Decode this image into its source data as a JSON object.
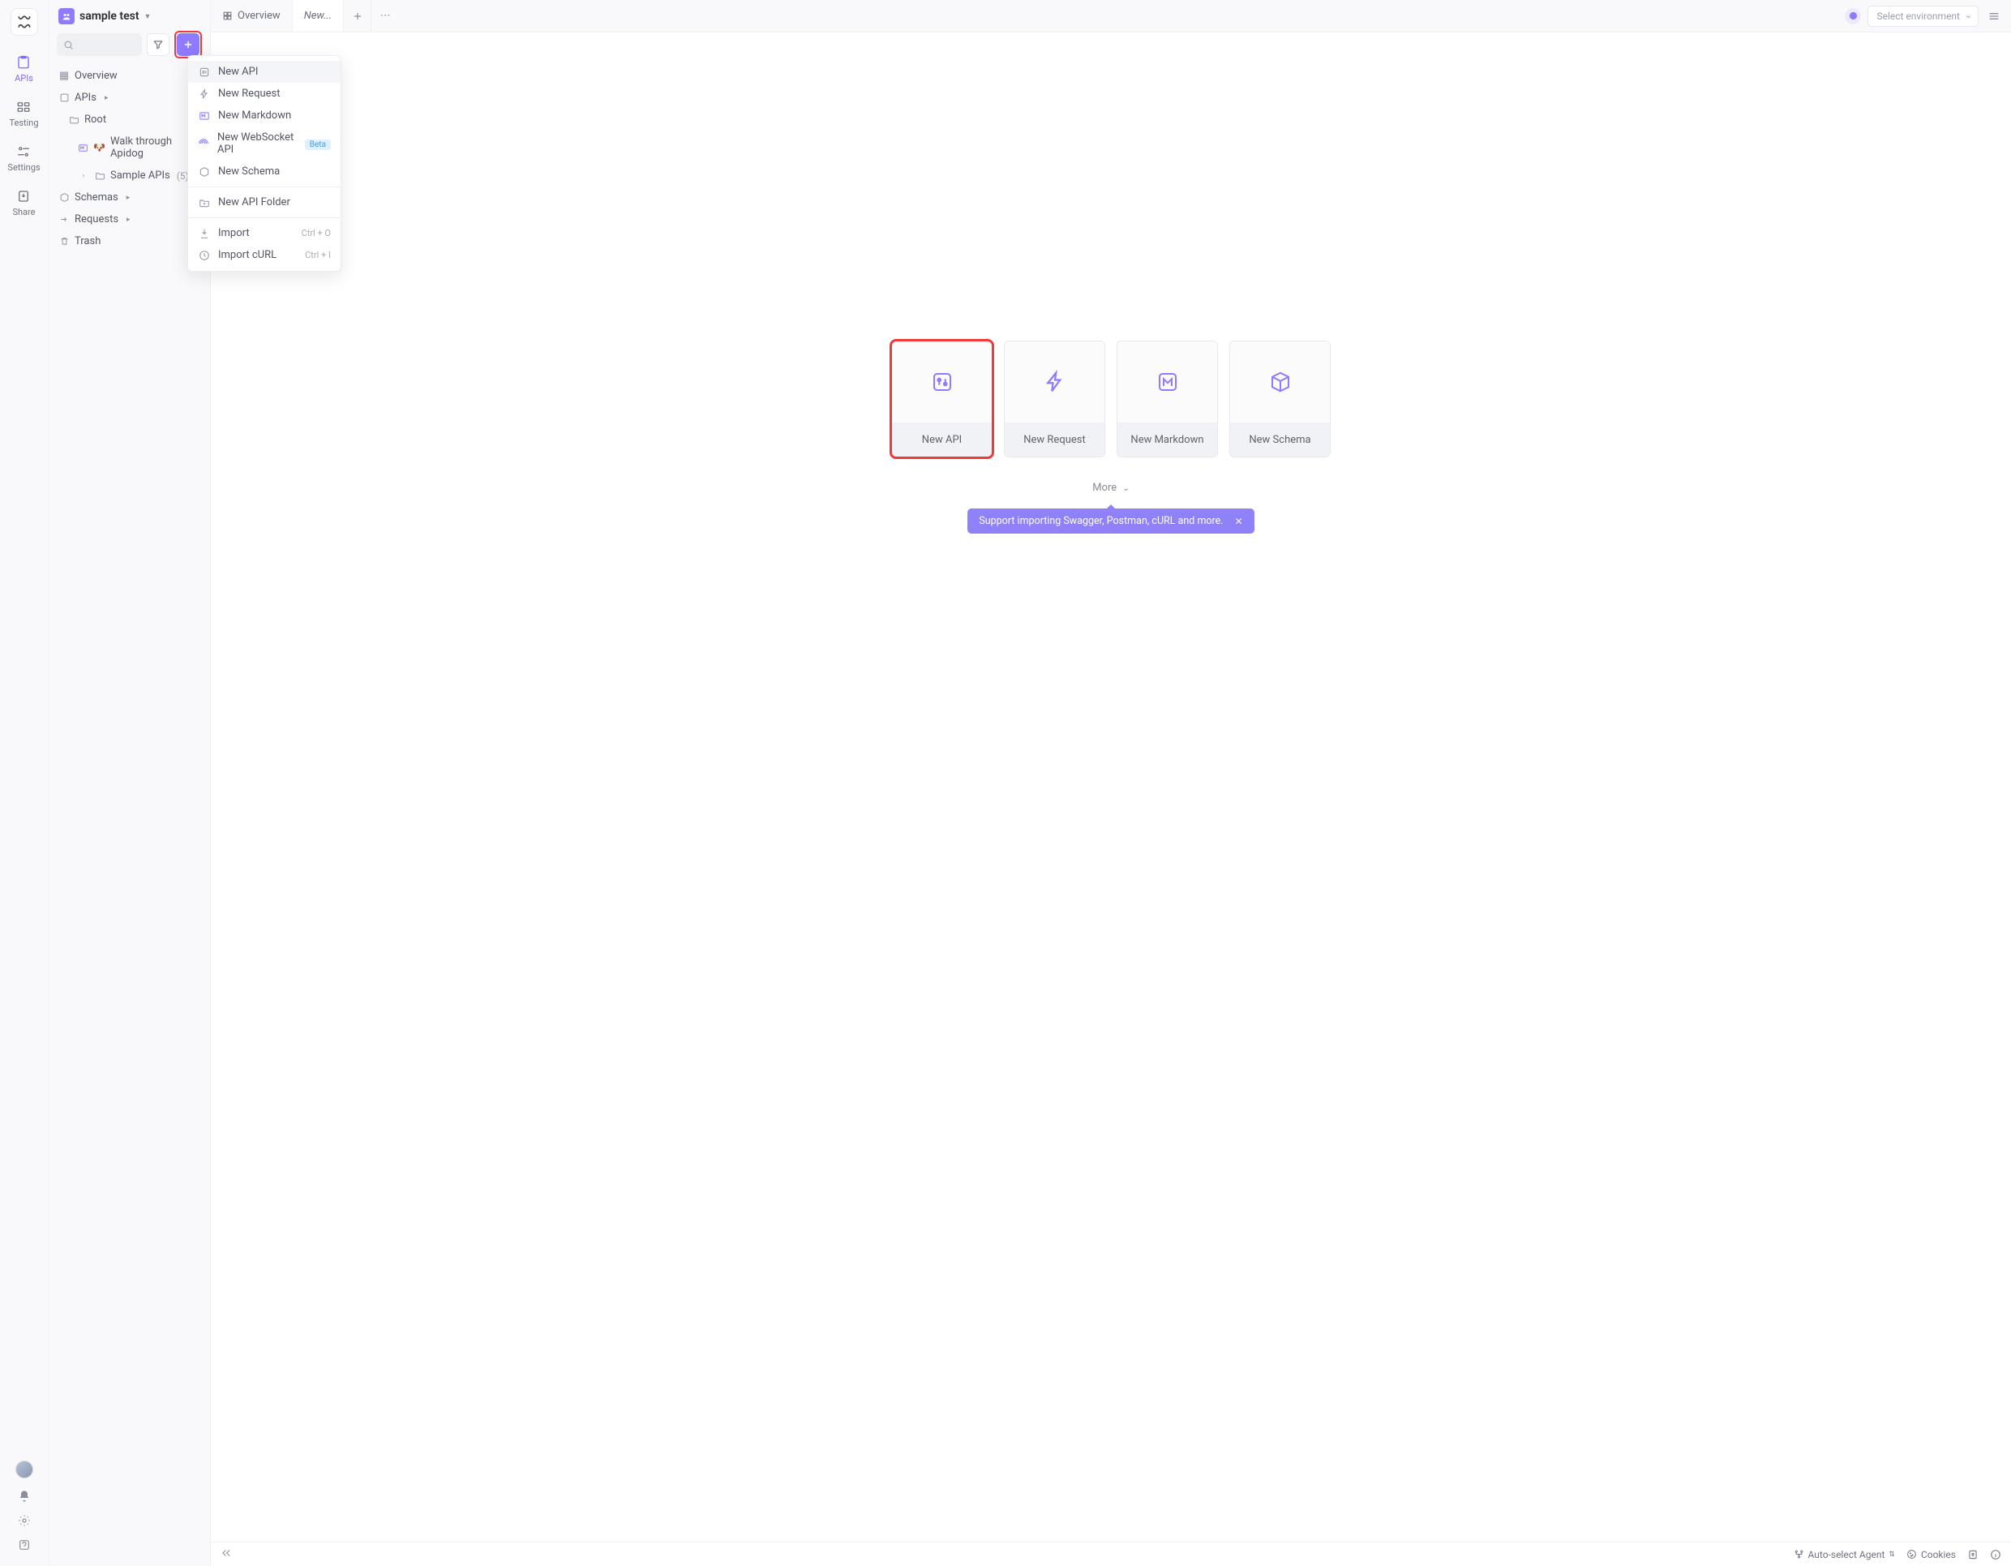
{
  "rail": {
    "items": [
      {
        "label": "APIs"
      },
      {
        "label": "Testing"
      },
      {
        "label": "Settings"
      },
      {
        "label": "Share"
      }
    ]
  },
  "project": {
    "name": "sample test"
  },
  "sidebar": {
    "overview": "Overview",
    "apis": "APIs",
    "root": "Root",
    "walk": "Walk through Apidog",
    "sample": "Sample APIs",
    "sample_count": "(5)",
    "schemas": "Schemas",
    "requests": "Requests",
    "trash": "Trash"
  },
  "dropdown": {
    "new_api": "New API",
    "new_request": "New Request",
    "new_markdown": "New Markdown",
    "new_websocket": "New WebSocket API",
    "beta": "Beta",
    "new_schema": "New Schema",
    "new_folder": "New API Folder",
    "import": "Import",
    "import_shortcut": "Ctrl + O",
    "import_curl": "Import cURL",
    "import_curl_shortcut": "Ctrl + I"
  },
  "tabs": {
    "overview": "Overview",
    "new": "New..."
  },
  "env": {
    "placeholder": "Select environment"
  },
  "cards": {
    "new_api": "New API",
    "new_request": "New Request",
    "new_markdown": "New Markdown",
    "new_schema": "New Schema"
  },
  "more_label": "More",
  "hint": "Support importing Swagger, Postman, cURL and more.",
  "status": {
    "agent": "Auto-select Agent",
    "cookies": "Cookies"
  }
}
